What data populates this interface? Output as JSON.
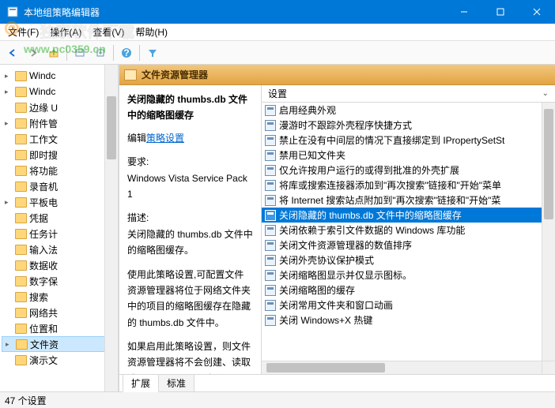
{
  "window": {
    "title": "本地组策略编辑器"
  },
  "menu": {
    "file": "文件(F)",
    "action": "操作(A)",
    "view": "查看(V)",
    "help": "帮助(H)"
  },
  "toolbar_icons": [
    "back",
    "forward",
    "up",
    "show",
    "export",
    "refresh",
    "help",
    "filter"
  ],
  "tree": {
    "items": [
      {
        "label": "Windc",
        "exp": "▸"
      },
      {
        "label": "Windc",
        "exp": "▸"
      },
      {
        "label": "边缘 U",
        "exp": ""
      },
      {
        "label": "附件管",
        "exp": "▸"
      },
      {
        "label": "工作文",
        "exp": ""
      },
      {
        "label": "即时搜",
        "exp": ""
      },
      {
        "label": "将功能",
        "exp": ""
      },
      {
        "label": "录音机",
        "exp": ""
      },
      {
        "label": "平板电",
        "exp": "▸"
      },
      {
        "label": "凭据",
        "exp": ""
      },
      {
        "label": "任务计",
        "exp": ""
      },
      {
        "label": "输入法",
        "exp": ""
      },
      {
        "label": "数据收",
        "exp": ""
      },
      {
        "label": "数字保",
        "exp": ""
      },
      {
        "label": "搜索",
        "exp": ""
      },
      {
        "label": "网络共",
        "exp": ""
      },
      {
        "label": "位置和",
        "exp": ""
      },
      {
        "label": "文件资",
        "exp": "▸",
        "selected": true
      },
      {
        "label": "演示文",
        "exp": ""
      }
    ]
  },
  "content": {
    "header": "文件资源管理器",
    "detail": {
      "title": "关闭隐藏的 thumbs.db 文件中的缩略图缓存",
      "edit_label": "编辑",
      "edit_link": "策略设置",
      "req_label": "要求:",
      "req_value": "Windows Vista Service Pack 1",
      "desc_label": "描述:",
      "desc1": "关闭隐藏的 thumbs.db 文件中的缩略图缓存。",
      "desc2": "使用此策略设置,可配置文件资源管理器将位于网络文件夹中的项目的缩略图缓存在隐藏的 thumbs.db 文件中。",
      "desc3": "如果启用此策略设置，则文件资源管理器将不会创建、读取或写入 thumbs.db 文件。"
    },
    "list": {
      "header": "设置",
      "items": [
        "启用经典外观",
        "漫游时不跟踪外壳程序快捷方式",
        "禁止在没有中间层的情况下直接绑定到 IPropertySetSt",
        "禁用已知文件夹",
        "仅允许按用户运行的或得到批准的外壳扩展",
        "将库或搜索连接器添加到\"再次搜索\"链接和\"开始\"菜单",
        "将 Internet 搜索站点附加到\"再次搜索\"链接和\"开始\"菜",
        "关闭隐藏的 thumbs.db 文件中的缩略图缓存",
        "关闭依赖于索引文件数据的 Windows 库功能",
        "关闭文件资源管理器的数值排序",
        "关闭外壳协议保护模式",
        "关闭缩略图显示并仅显示图标。",
        "关闭缩略图的缓存",
        "关闭常用文件夹和窗口动画",
        "关闭 Windows+X 热键"
      ],
      "selected_index": 7
    },
    "tabs": {
      "extended": "扩展",
      "standard": "标准"
    }
  },
  "status": {
    "text": "47 个设置"
  },
  "watermark": {
    "logo": "⊚",
    "text": "独家软件下载",
    "url": "www.pc0359.cn"
  }
}
